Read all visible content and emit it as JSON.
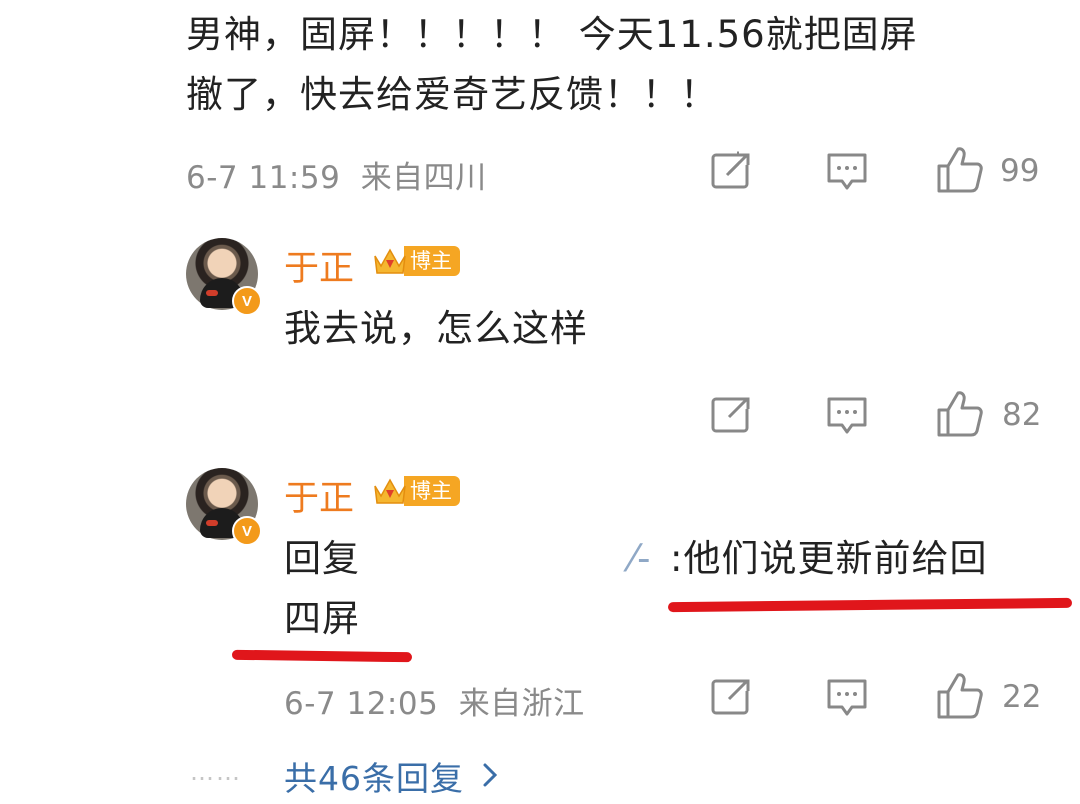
{
  "comments": [
    {
      "text_line1": "男神，固屏！！！！！ 今天11.56就把固屏",
      "text_line2": "撤了，快去给爱奇艺反馈！！！",
      "time": "6-7 11:59",
      "location": "来自四川",
      "likes": "99"
    },
    {
      "author": "于正",
      "badge": "博主",
      "verified_mark": "V",
      "text": "我去说，怎么这样",
      "likes": "82"
    },
    {
      "author": "于正",
      "badge": "博主",
      "verified_mark": "V",
      "reply_prefix": "回复",
      "reply_fragment": "⁄-",
      "reply_text": ":他们说更新前给回",
      "reply_line2": "四屏",
      "time": "6-7 12:05",
      "location": "来自浙江",
      "likes": "22"
    }
  ],
  "footer": {
    "more_replies": "共46条回复",
    "dots": "……"
  },
  "icons": [
    "share-icon",
    "comment-icon",
    "like-icon",
    "chevron-right-icon"
  ],
  "colors": {
    "name": "#ee7b1f",
    "badge": "#f5a623",
    "underline": "#e0161b",
    "link": "#3a6ea8",
    "meta": "#8a8a8a"
  }
}
